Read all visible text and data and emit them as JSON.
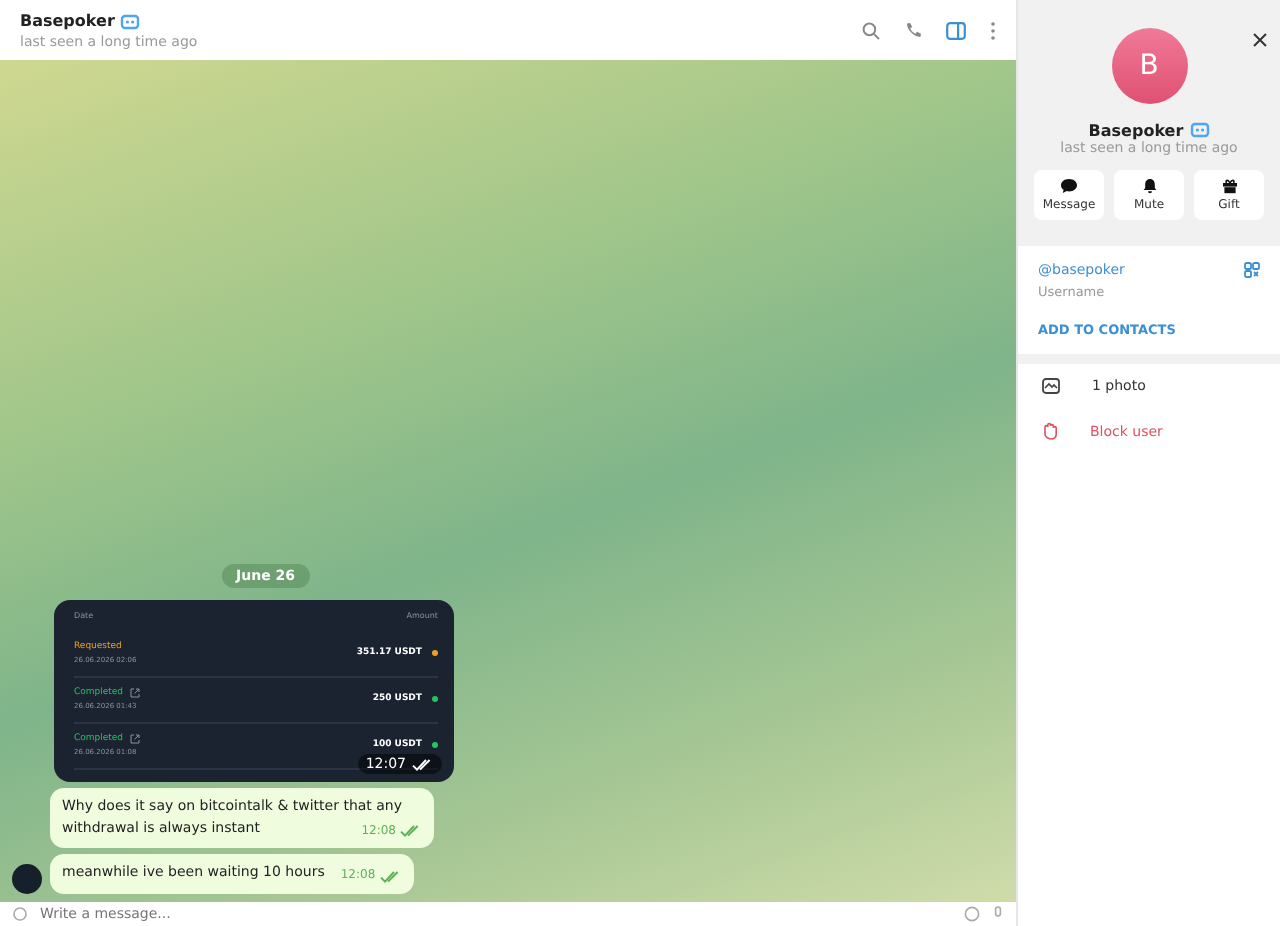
{
  "chat_header": {
    "title": "Basepoker",
    "status": "last seen a long time ago"
  },
  "date_badge": "June 26",
  "screenshot_message": {
    "columns": [
      "Date",
      "Amount"
    ],
    "time": "12:07",
    "rows": [
      {
        "status": "Requested",
        "date": "26.06.2026 02:06",
        "amount": "351.17 USDT",
        "color": "#f0a020",
        "link": false
      },
      {
        "status": "Completed",
        "date": "26.06.2026 01:43",
        "amount": "250 USDT",
        "color": "#22c55e",
        "link": true
      },
      {
        "status": "Completed",
        "date": "26.06.2026 01:08",
        "amount": "100 USDT",
        "color": "#22c55e",
        "link": true
      }
    ]
  },
  "messages": [
    {
      "text": "Why does it say on bitcointalk & twitter that any withdrawal is always instant",
      "time": "12:08",
      "avatar": false
    },
    {
      "text": "meanwhile ive been waiting 10 hours",
      "time": "12:08",
      "avatar": true
    }
  ],
  "composer": {
    "placeholder": "Write a message..."
  },
  "profile": {
    "avatar_letter": "B",
    "name": "Basepoker",
    "status": "last seen a long time ago",
    "actions": [
      {
        "kind": "message",
        "label": "Message"
      },
      {
        "kind": "mute",
        "label": "Mute"
      },
      {
        "kind": "gift",
        "label": "Gift"
      }
    ],
    "username": "@basepoker",
    "username_caption": "Username",
    "add_contact": "ADD TO CONTACTS",
    "photos": "1 photo",
    "block": "Block user"
  }
}
